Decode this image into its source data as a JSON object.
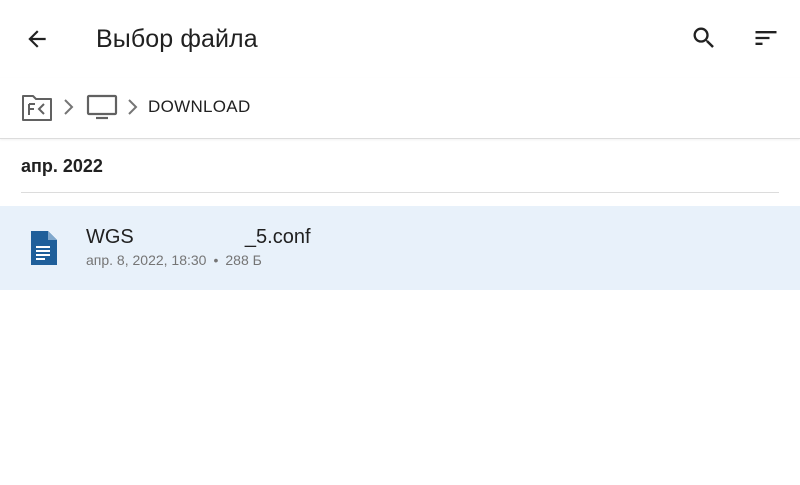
{
  "appbar": {
    "title": "Выбор файла",
    "back_icon": "arrow-back-icon",
    "search_icon": "search-icon",
    "sort_icon": "sort-icon"
  },
  "breadcrumb": {
    "root_icon": "file-commander-icon",
    "device_icon": "monitor-icon",
    "separator_icon": "chevron-right-icon",
    "current": "DOWNLOAD"
  },
  "section": {
    "header": "апр. 2022"
  },
  "files": [
    {
      "name": "WGS                    _5.conf",
      "date": "апр. 8, 2022, 18:30",
      "separator": "•",
      "size": "288 Б",
      "icon": "document-icon"
    }
  ],
  "colors": {
    "accent": "#1f5f9a",
    "selected_row": "#e8f1fa",
    "icon_gray": "#424242"
  }
}
